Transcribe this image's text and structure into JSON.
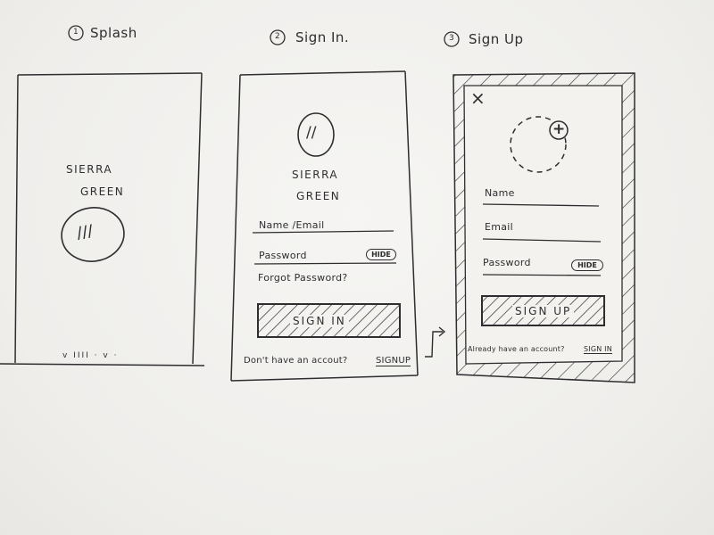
{
  "screens": [
    {
      "number": "1",
      "title": "Splash",
      "brand_line1": "SIERRA",
      "brand_line2": "GREEN",
      "logo_mark": "///",
      "footer": "v IIII · v ·"
    },
    {
      "number": "2",
      "title": "Sign In.",
      "logo_mark": "//",
      "brand_line1": "SIERRA",
      "brand_line2": "GREEN",
      "name_field": "Name /Email",
      "password_field": "Password",
      "hide_label": "HIDE",
      "forgot_label": "Forgot Password?",
      "button_label": "SIGN IN",
      "footer_text": "Don't have an accout?",
      "footer_link": "SIGNUP"
    },
    {
      "number": "3",
      "title": "Sign Up",
      "close_glyph": "×",
      "add_glyph": "+",
      "name_field": "Name",
      "email_field": "Email",
      "password_field": "Password",
      "hide_label": "HIDE",
      "button_label": "SIGN UP",
      "footer_text": "Already have an account?",
      "footer_link": "SIGN IN"
    }
  ]
}
